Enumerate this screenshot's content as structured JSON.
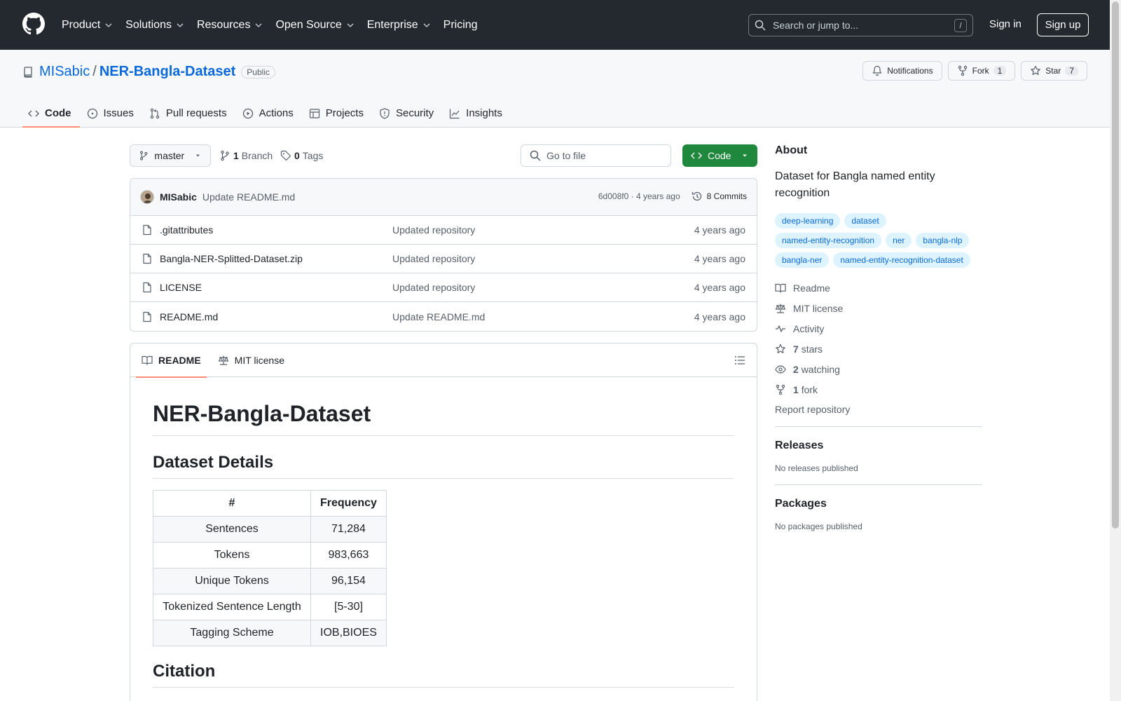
{
  "header": {
    "nav": [
      {
        "label": "Product",
        "has_menu": true
      },
      {
        "label": "Solutions",
        "has_menu": true
      },
      {
        "label": "Resources",
        "has_menu": true
      },
      {
        "label": "Open Source",
        "has_menu": true
      },
      {
        "label": "Enterprise",
        "has_menu": true
      },
      {
        "label": "Pricing",
        "has_menu": false
      }
    ],
    "search_placeholder": "Search or jump to...",
    "search_shortcut": "/",
    "sign_in": "Sign in",
    "sign_up": "Sign up"
  },
  "repo": {
    "owner": "MISabic",
    "separator": "/",
    "name": "NER-Bangla-Dataset",
    "visibility": "Public",
    "notifications_label": "Notifications",
    "fork_label": "Fork",
    "fork_count": "1",
    "star_label": "Star",
    "star_count": "7",
    "tabs": [
      {
        "label": "Code",
        "icon": "code-icon",
        "active": true
      },
      {
        "label": "Issues",
        "icon": "issue-opened-icon",
        "active": false
      },
      {
        "label": "Pull requests",
        "icon": "git-pull-request-icon",
        "active": false
      },
      {
        "label": "Actions",
        "icon": "play-icon",
        "active": false
      },
      {
        "label": "Projects",
        "icon": "table-icon",
        "active": false
      },
      {
        "label": "Security",
        "icon": "shield-icon",
        "active": false
      },
      {
        "label": "Insights",
        "icon": "graph-icon",
        "active": false
      }
    ]
  },
  "code": {
    "branch": "master",
    "branch_count": "1",
    "branch_label": "Branch",
    "tag_count": "0",
    "tag_label": "Tags",
    "go_to_file": "Go to file",
    "code_button": "Code"
  },
  "commit": {
    "author": "MISabic",
    "message": "Update README.md",
    "hash": "6d008f0",
    "age": "· 4 years ago",
    "commits_label": "8 Commits"
  },
  "files": [
    {
      "name": ".gitattributes",
      "message": "Updated repository",
      "age": "4 years ago"
    },
    {
      "name": "Bangla-NER-Splitted-Dataset.zip",
      "message": "Updated repository",
      "age": "4 years ago"
    },
    {
      "name": "LICENSE",
      "message": "Updated repository",
      "age": "4 years ago"
    },
    {
      "name": "README.md",
      "message": "Update README.md",
      "age": "4 years ago"
    }
  ],
  "readme": {
    "tab_readme": "README",
    "tab_license": "MIT license",
    "title": "NER-Bangla-Dataset",
    "section1": "Dataset Details",
    "table_headers": [
      "#",
      "Frequency"
    ],
    "table_rows": [
      [
        "Sentences",
        "71,284"
      ],
      [
        "Tokens",
        "983,663"
      ],
      [
        "Unique Tokens",
        "96,154"
      ],
      [
        "Tokenized Sentence Length",
        "[5-30]"
      ],
      [
        "Tagging Scheme",
        "IOB,BIOES"
      ]
    ],
    "section2": "Citation"
  },
  "about": {
    "heading": "About",
    "description": "Dataset for Bangla named entity recognition",
    "topics": [
      "deep-learning",
      "dataset",
      "named-entity-recognition",
      "ner",
      "bangla-nlp",
      "bangla-ner",
      "named-entity-recognition-dataset"
    ],
    "links": {
      "readme": "Readme",
      "license": "MIT license",
      "activity": "Activity",
      "stars_count": "7",
      "stars_label": "stars",
      "watching_count": "2",
      "watching_label": "watching",
      "fork_count": "1",
      "fork_label": "fork"
    },
    "report": "Report repository"
  },
  "releases": {
    "heading": "Releases",
    "text": "No releases published"
  },
  "packages": {
    "heading": "Packages",
    "text": "No packages published"
  },
  "colors": {
    "header_bg": "#24292f",
    "accent": "#0969da",
    "green": "#1f883d",
    "tab_underline": "#fd8c73"
  }
}
